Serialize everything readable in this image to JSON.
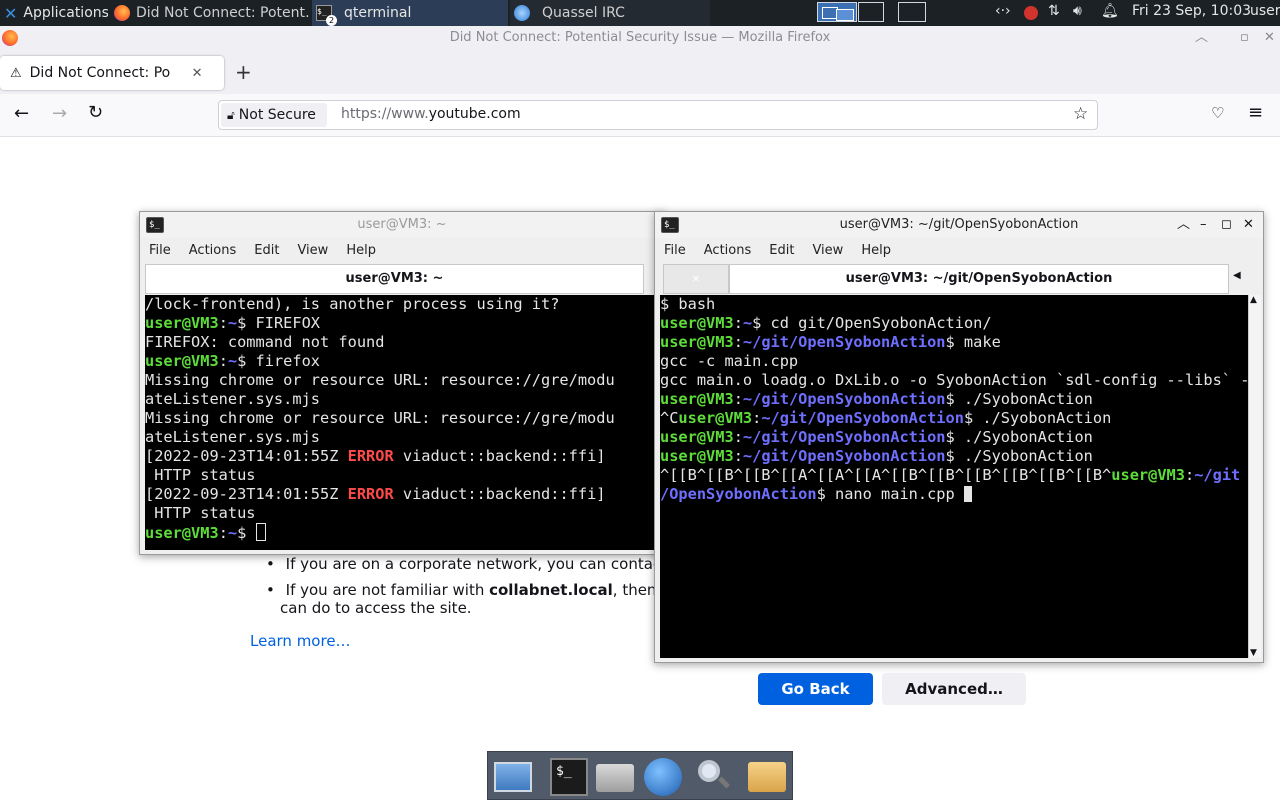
{
  "panel": {
    "applications": "Applications",
    "tasks": [
      {
        "label": "Did Not Connect: Potent…"
      },
      {
        "label": "qterminal",
        "badge": "2"
      },
      {
        "label": "Quassel IRC"
      }
    ],
    "clock": "Fri 23 Sep, 10:03",
    "user": "user"
  },
  "firefox": {
    "window_title": "Did Not Connect: Potential Security Issue — Mozilla Firefox",
    "tab_title": "Did Not Connect: Potentia",
    "not_secure": "Not Secure",
    "url_prefix": "https://www.",
    "url_domain": "youtube.com"
  },
  "errorpage": {
    "bullet1": "If you are on a corporate network, you can contac",
    "bullet2_pre": "If you are not familiar with ",
    "bullet2_bold": "collabnet.local",
    "bullet2_post": ", then",
    "bullet2_line2": "can do to access the site.",
    "learn_more": "Learn more…",
    "go_back": "Go Back",
    "advanced": "Advanced…"
  },
  "term_menu": [
    "File",
    "Actions",
    "Edit",
    "View",
    "Help"
  ],
  "terminal1": {
    "title": "user@VM3: ~",
    "tab": "user@VM3: ~",
    "lines": [
      [
        {
          "t": "/lock-frontend), is another process using it?"
        }
      ],
      [
        {
          "t": "user@VM3",
          "c": "g"
        },
        {
          "t": ":"
        },
        {
          "t": "~",
          "c": "b"
        },
        {
          "t": "$ FIREFOX"
        }
      ],
      [
        {
          "t": "FIREFOX: command not found"
        }
      ],
      [
        {
          "t": "user@VM3",
          "c": "g"
        },
        {
          "t": ":"
        },
        {
          "t": "~",
          "c": "b"
        },
        {
          "t": "$ firefox"
        }
      ],
      [
        {
          "t": "Missing chrome or resource URL: resource://gre/modu"
        }
      ],
      [
        {
          "t": "ateListener.sys.mjs"
        }
      ],
      [
        {
          "t": "Missing chrome or resource URL: resource://gre/modu"
        }
      ],
      [
        {
          "t": "ateListener.sys.mjs"
        }
      ],
      [
        {
          "t": "[2022-09-23T14:01:55Z "
        },
        {
          "t": "ERROR",
          "c": "r"
        },
        {
          "t": " viaduct::backend::ffi]"
        }
      ],
      [
        {
          "t": " HTTP status"
        }
      ],
      [
        {
          "t": "[2022-09-23T14:01:55Z "
        },
        {
          "t": "ERROR",
          "c": "r"
        },
        {
          "t": " viaduct::backend::ffi]"
        }
      ],
      [
        {
          "t": " HTTP status"
        }
      ],
      [
        {
          "t": "user@VM3",
          "c": "g"
        },
        {
          "t": ":"
        },
        {
          "t": "~",
          "c": "b"
        },
        {
          "t": "$ "
        }
      ]
    ]
  },
  "terminal2": {
    "title": "user@VM3: ~/git/OpenSyobonAction",
    "tab": "user@VM3: ~/git/OpenSyobonAction",
    "lines": [
      [
        {
          "t": "$ bash"
        }
      ],
      [
        {
          "t": "user@VM3",
          "c": "g"
        },
        {
          "t": ":"
        },
        {
          "t": "~",
          "c": "b"
        },
        {
          "t": "$ cd git/OpenSyobonAction/"
        }
      ],
      [
        {
          "t": "user@VM3",
          "c": "g"
        },
        {
          "t": ":"
        },
        {
          "t": "~/git/OpenSyobonAction",
          "c": "b"
        },
        {
          "t": "$ make"
        }
      ],
      [
        {
          "t": "gcc -c main.cpp"
        }
      ],
      [
        {
          "t": "gcc main.o loadg.o DxLib.o -o SyobonAction `sdl-config --libs` -"
        }
      ],
      [
        {
          "t": "user@VM3",
          "c": "g"
        },
        {
          "t": ":"
        },
        {
          "t": "~/git/OpenSyobonAction",
          "c": "b"
        },
        {
          "t": "$ ./SyobonAction"
        }
      ],
      [
        {
          "t": "^C"
        },
        {
          "t": "user@VM3",
          "c": "g"
        },
        {
          "t": ":"
        },
        {
          "t": "~/git/OpenSyobonAction",
          "c": "b"
        },
        {
          "t": "$ ./SyobonAction"
        }
      ],
      [
        {
          "t": "user@VM3",
          "c": "g"
        },
        {
          "t": ":"
        },
        {
          "t": "~/git/OpenSyobonAction",
          "c": "b"
        },
        {
          "t": "$ ./SyobonAction"
        }
      ],
      [
        {
          "t": "user@VM3",
          "c": "g"
        },
        {
          "t": ":"
        },
        {
          "t": "~/git/OpenSyobonAction",
          "c": "b"
        },
        {
          "t": "$ ./SyobonAction"
        }
      ],
      [
        {
          "t": "^[[B^[[B^[[B^[[A^[[A^[[A^[[B^[[B^[[B^[[B^[[B^[[B^"
        },
        {
          "t": "user@VM3",
          "c": "g"
        },
        {
          "t": ":"
        },
        {
          "t": "~/git",
          "c": "b"
        }
      ],
      [
        {
          "t": "/OpenSyobonAction",
          "c": "b"
        },
        {
          "t": "$ nano main.cpp "
        }
      ]
    ]
  },
  "colors": {
    "panel_bg": "#1c2126",
    "prompt_user": "#5ddc3a",
    "prompt_path": "#6f6fff",
    "error_red": "#ff4a4a",
    "accent_blue": "#0061e0"
  },
  "icons": [
    "xfce-logo-icon",
    "firefox-icon",
    "terminal-icon",
    "quassel-icon",
    "network-icon",
    "notification-bell-icon",
    "volume-icon",
    "warning-icon",
    "lock-slash-icon",
    "bookmark-star-icon",
    "pocket-icon",
    "hamburger-menu-icon",
    "back-arrow-icon",
    "forward-arrow-icon",
    "reload-icon"
  ]
}
